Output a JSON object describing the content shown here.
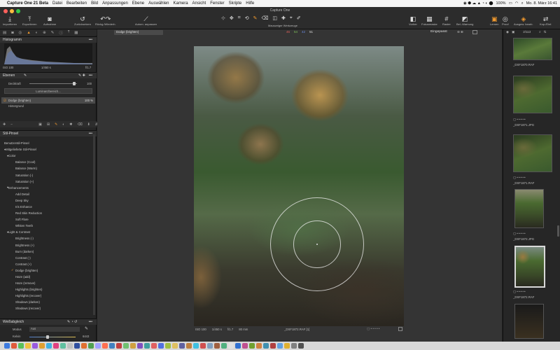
{
  "menubar": {
    "app": "Capture One 21 Beta",
    "items": [
      "Datei",
      "Bearbeiten",
      "Bild",
      "Anpassungen",
      "Ebene",
      "Auswählen",
      "Kamera",
      "Ansicht",
      "Fenster",
      "Skripte",
      "Hilfe"
    ],
    "battery": "100%",
    "clock": "Mo. 8. März 16:41"
  },
  "window": {
    "title": "Capture One"
  },
  "toolbar": {
    "left": [
      "Importieren",
      "Exportieren",
      "Aufnahme",
      "Zurücksetzen",
      "Rückg./Wiederh.",
      "Autom. anpassen"
    ],
    "center_label": "Mauszeiger Werkzeuge",
    "right": [
      "Vorher",
      "Fokusmaske",
      "Raster",
      "Bel.-Warnung",
      "Lernen",
      "Proof",
      "Ausgew. bearb.",
      "Kop./Einf."
    ]
  },
  "viewer": {
    "layer_chip": "Dodge (brighten)",
    "readout": [
      "46",
      "54",
      "42",
      "51"
    ],
    "fit": "Eingepasst",
    "count": "2/113",
    "meta": {
      "iso": "ISO 100",
      "shutter": "1/450 s",
      "aperture": "f/1.7",
      "focal": "80 mm",
      "filename": "_DSF1872.RAF [1]"
    }
  },
  "histogram": {
    "title": "Histogramm",
    "iso": "ISO 100",
    "shutter": "1/450 s",
    "aperture": "f/1.7"
  },
  "layers": {
    "title": "Ebenen",
    "opacity_label": "Deckkraft",
    "opacity_value": "100",
    "luminance_button": "Luminanzbereich...",
    "layer_name": "Dodge (brighten)",
    "layer_pct": "100 %",
    "background": "Hintergrund"
  },
  "styles": {
    "title": "Stil-Pinsel",
    "user": "Benutzerstil-Pinsel",
    "builtin": "Mitgelieferte Stil-Pinsel",
    "color_group": "Color",
    "color_items": [
      "Balance (Cool)",
      "Balance (Warm)",
      "Saturation (-)",
      "Saturation (+)"
    ],
    "enh_group": "Enhancements",
    "enh_items": [
      "Add Detail",
      "Deep Sky",
      "Iris Enhance",
      "Red Skin Reduction",
      "Soft Flare",
      "Whiten Teeth"
    ],
    "lc_group": "Light & Contrast",
    "lc_items": [
      "Brightness (-)",
      "Brightness (+)",
      "Burn (darken)",
      "Contrast (-)",
      "Contrast (+)",
      "Dodge (brighten)",
      "Haze (add)",
      "Haze (remove)",
      "Highlights (brighten)",
      "Highlights (recover)",
      "Shadows (darken)",
      "Shadows (recover)"
    ]
  },
  "wb": {
    "title": "Weißabgleich",
    "mode_label": "Modus",
    "mode_value": "Aus",
    "kelvin_label": "Kelvin",
    "kelvin_value": "6443"
  },
  "thumbs": [
    {
      "name": "_DSF1870.RAF"
    },
    {
      "name": "_DSF1871.JPG"
    },
    {
      "name": "_DSF1871.RAF"
    },
    {
      "name": "_DSF1872.JPG"
    },
    {
      "name": "_DSF1872.RAF"
    }
  ]
}
